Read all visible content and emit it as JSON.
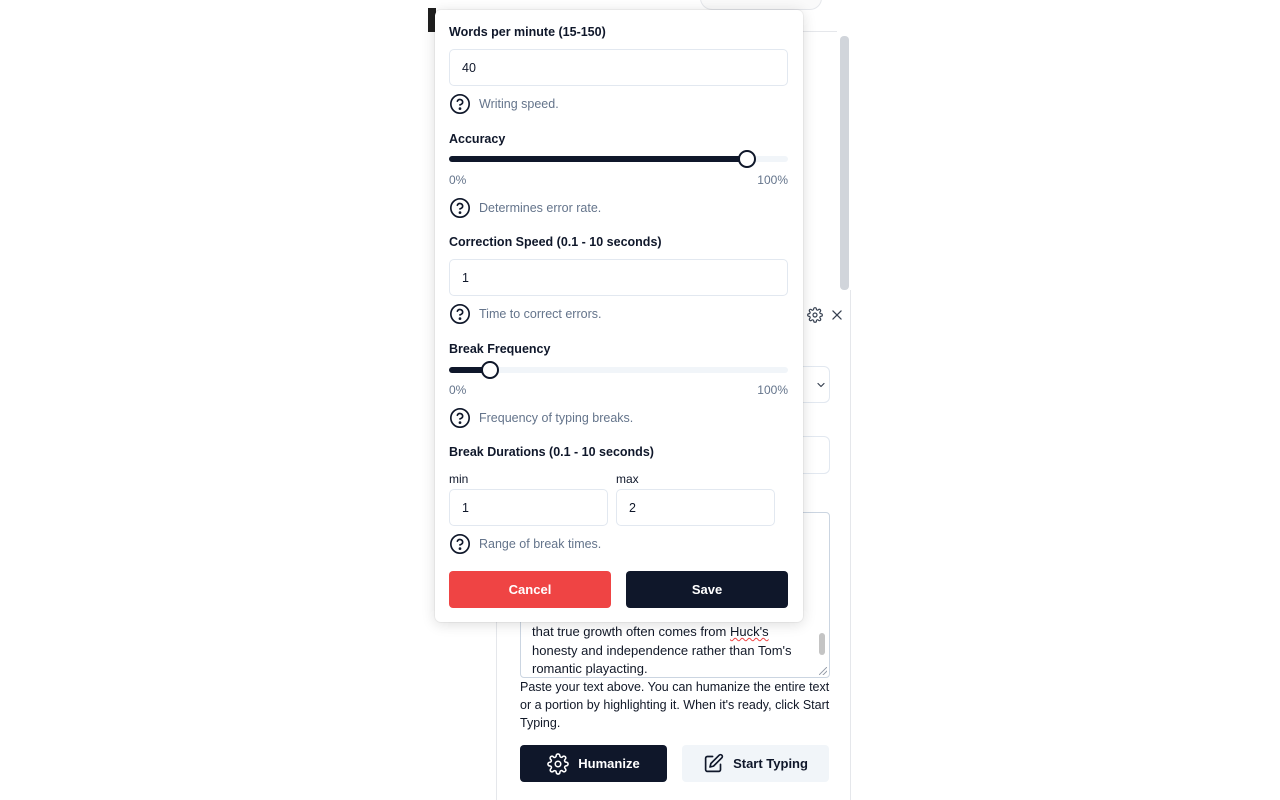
{
  "settings": {
    "wpm": {
      "label": "Words per minute (15-150)",
      "value": "40",
      "hint": "Writing speed."
    },
    "accuracy": {
      "label": "Accuracy",
      "value_percent": 88,
      "min_label": "0%",
      "max_label": "100%",
      "hint": "Determines error rate."
    },
    "correction_speed": {
      "label": "Correction Speed (0.1 - 10 seconds)",
      "value": "1",
      "hint": "Time to correct errors."
    },
    "break_frequency": {
      "label": "Break Frequency",
      "value_percent": 12,
      "min_label": "0%",
      "max_label": "100%",
      "hint": "Frequency of typing breaks."
    },
    "break_durations": {
      "label": "Break Durations (0.1 - 10 seconds)",
      "min_label": "min",
      "min_value": "1",
      "max_label": "max",
      "max_value": "2",
      "hint": "Range of break times."
    },
    "cancel_label": "Cancel",
    "save_label": "Save"
  },
  "panel": {
    "text_before": "that true growth often comes from ",
    "text_misspelled": "Huck's",
    "text_after": " honesty and independence rather than Tom's romantic playacting.",
    "help_text": "Paste your text above. You can humanize the entire text or a portion by highlighting it. When it's ready, click Start Typing.",
    "humanize_label": "Humanize",
    "start_typing_label": "Start Typing"
  },
  "colors": {
    "primary": "#0f172a",
    "danger": "#ef4444",
    "muted": "#64748b",
    "secondary_bg": "#f1f5f9"
  },
  "icons": [
    "help-circle-icon",
    "gear-icon",
    "close-icon",
    "chevron-down-icon",
    "edit-icon"
  ]
}
